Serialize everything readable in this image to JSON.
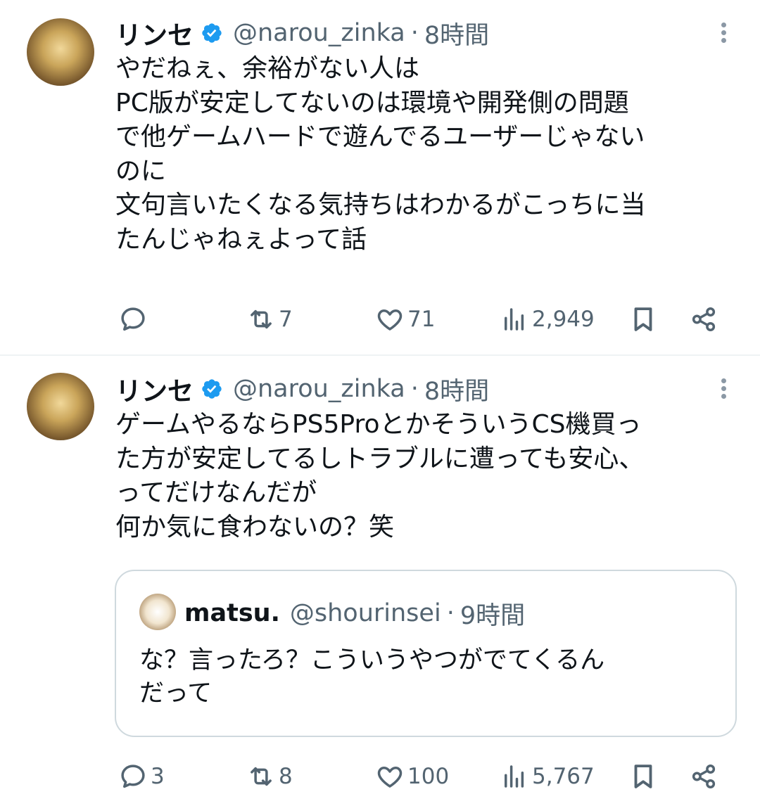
{
  "tweets": [
    {
      "author": {
        "name": "リンセ",
        "handle": "@narou_zinka",
        "time": "8時間",
        "separator": "·"
      },
      "lines": [
        "やだねぇ、余裕がない人は",
        "PC版が安定してないのは環境や開発側の問題",
        "で他ゲームハードで遊んでるユーザーじゃない",
        "のに",
        "文句言いたくなる気持ちはわかるがこっちに当",
        "たんじゃねぇよって話"
      ],
      "actions": {
        "replies": "",
        "retweets": "7",
        "likes": "71",
        "views": "2,949"
      }
    },
    {
      "author": {
        "name": "リンセ",
        "handle": "@narou_zinka",
        "time": "8時間",
        "separator": "·"
      },
      "lines": [
        "ゲームやるならPS5ProとかそういうCS機買っ",
        "た方が安定してるしトラブルに遭っても安心、",
        "ってだけなんだが",
        "何か気に食わないの？笑"
      ],
      "quote": {
        "name": "matsu.",
        "handle": "@shourinsei",
        "time": "9時間",
        "separator": "·",
        "lines": [
          "な？言ったろ？こういうやつがでてくるん",
          "だって"
        ]
      },
      "actions": {
        "replies": "3",
        "retweets": "8",
        "likes": "100",
        "views": "5,767"
      }
    }
  ],
  "icons": {
    "verified": "verified-badge-icon",
    "more": "more-options-icon",
    "reply": "reply-icon",
    "retweet": "retweet-icon",
    "like": "heart-icon",
    "views": "views-icon",
    "bookmark": "bookmark-icon",
    "share": "share-icon"
  },
  "colors": {
    "verified": "#1d9bf0",
    "muted": "#536471",
    "text": "#0f1419",
    "border": "#cfd9de"
  }
}
